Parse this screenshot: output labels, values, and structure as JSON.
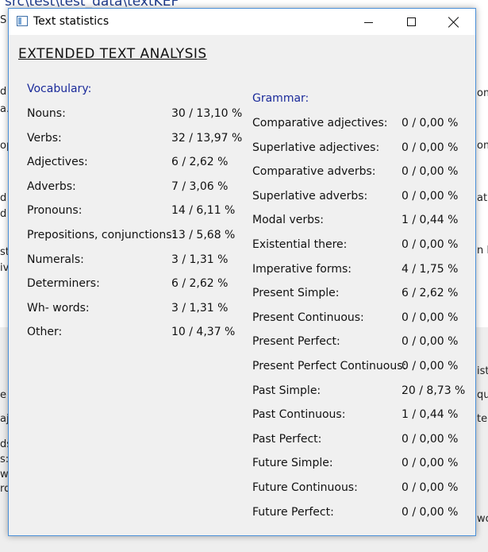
{
  "background": {
    "path_text": "src\\test\\test_data\\textKEF",
    "fragments": [
      "S",
      "d",
      "a.",
      "op",
      "d",
      "d s",
      "st",
      "iv",
      "e",
      "aj",
      "ds",
      "s:",
      "w",
      "rd",
      "om",
      "om",
      "at",
      "n N",
      "ist",
      "qu",
      "ter",
      "wo"
    ]
  },
  "window": {
    "title": "Text statistics",
    "controls": {
      "minimize": "minimize",
      "maximize": "maximize",
      "close": "close"
    }
  },
  "heading": "EXTENDED TEXT ANALYSIS",
  "vocabulary": {
    "title": "Vocabulary:",
    "items": [
      {
        "label": "Nouns:",
        "value": "30 / 13,10 %"
      },
      {
        "label": "Verbs:",
        "value": "32 / 13,97 %"
      },
      {
        "label": "Adjectives:",
        "value": "6 / 2,62 %"
      },
      {
        "label": "Adverbs:",
        "value": "7 / 3,06 %"
      },
      {
        "label": "Pronouns:",
        "value": "14 / 6,11 %"
      },
      {
        "label": "Prepositions, conjunctions:",
        "value": "13 / 5,68 %"
      },
      {
        "label": "Numerals:",
        "value": "3 / 1,31 %"
      },
      {
        "label": "Determiners:",
        "value": "6 / 2,62 %"
      },
      {
        "label": "Wh- words:",
        "value": "3 / 1,31 %"
      },
      {
        "label": "Other:",
        "value": "10 / 4,37 %"
      }
    ]
  },
  "grammar": {
    "title": "Grammar:",
    "items": [
      {
        "label": "Comparative adjectives:",
        "value": "0 / 0,00 %"
      },
      {
        "label": "Superlative adjectives:",
        "value": "0 / 0,00 %"
      },
      {
        "label": "Comparative adverbs:",
        "value": "0 / 0,00 %"
      },
      {
        "label": "Superlative adverbs:",
        "value": "0 / 0,00 %"
      },
      {
        "label": "Modal verbs:",
        "value": "1 / 0,44 %"
      },
      {
        "label": "Existential there:",
        "value": "0 / 0,00 %"
      },
      {
        "label": "Imperative forms:",
        "value": "4 / 1,75 %"
      },
      {
        "label": "Present Simple:",
        "value": "6 / 2,62 %"
      },
      {
        "label": "Present Continuous:",
        "value": "0 / 0,00 %"
      },
      {
        "label": "Present Perfect:",
        "value": "0 / 0,00 %"
      },
      {
        "label": "Present Perfect Continuous:",
        "value": "0 / 0,00 %"
      },
      {
        "label": "Past Simple:",
        "value": "20 / 8,73 %"
      },
      {
        "label": "Past Continuous:",
        "value": "1 / 0,44 %"
      },
      {
        "label": "Past Perfect:",
        "value": "0 / 0,00 %"
      },
      {
        "label": "Future Simple:",
        "value": "0 / 0,00 %"
      },
      {
        "label": "Future Continuous:",
        "value": "0 / 0,00 %"
      },
      {
        "label": "Future Perfect:",
        "value": "0 / 0,00 %"
      }
    ]
  }
}
